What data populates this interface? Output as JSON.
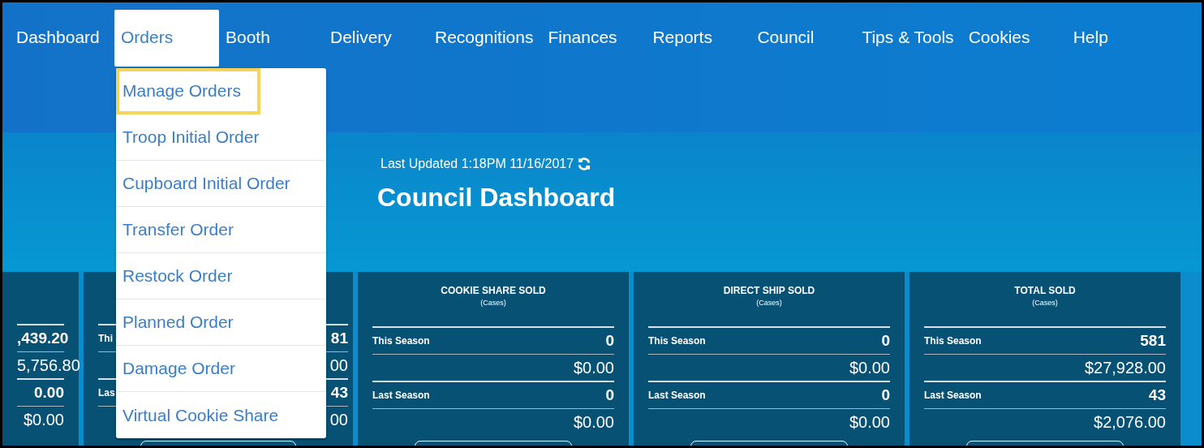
{
  "nav": {
    "items": [
      {
        "label": "Dashboard",
        "selected": false
      },
      {
        "label": "Orders",
        "selected": true
      },
      {
        "label": "Booth",
        "selected": false
      },
      {
        "label": "Delivery",
        "selected": false
      },
      {
        "label": "Recognitions",
        "selected": false
      },
      {
        "label": "Finances",
        "selected": false
      },
      {
        "label": "Reports",
        "selected": false
      },
      {
        "label": "Council",
        "selected": false
      },
      {
        "label": "Tips & Tools",
        "selected": false
      },
      {
        "label": "Cookies",
        "selected": false
      },
      {
        "label": "Help",
        "selected": false
      }
    ]
  },
  "orders_menu": {
    "items": [
      {
        "label": "Manage Orders",
        "highlighted": true
      },
      {
        "label": "Troop Initial Order",
        "highlighted": false
      },
      {
        "label": "Cupboard Initial Order",
        "highlighted": false
      },
      {
        "label": "Transfer Order",
        "highlighted": false
      },
      {
        "label": "Restock Order",
        "highlighted": false
      },
      {
        "label": "Planned Order",
        "highlighted": false
      },
      {
        "label": "Damage Order",
        "highlighted": false
      },
      {
        "label": "Virtual Cookie Share",
        "highlighted": false
      }
    ]
  },
  "header": {
    "last_updated": "Last Updated 1:18PM 11/16/2017",
    "title": "Council Dashboard"
  },
  "cards": [
    {
      "kind": "cut",
      "this_season_count": ",439.20",
      "this_season_amount": "5,756.80",
      "last_season_count": "0.00",
      "last_season_amount": "$0.00"
    },
    {
      "kind": "covered",
      "this_season_label": "Thi",
      "last_season_label": "Las",
      "this_season_count": "81",
      "this_season_amount": "00",
      "last_season_count": "43",
      "last_season_amount": "00"
    },
    {
      "kind": "full",
      "title": "COOKIE SHARE SOLD",
      "unit": "(Cases)",
      "this_season_label": "This Season",
      "this_season_count": "0",
      "this_season_amount": "$0.00",
      "last_season_label": "Last Season",
      "last_season_count": "0",
      "last_season_amount": "$0.00"
    },
    {
      "kind": "full",
      "title": "DIRECT SHIP SOLD",
      "unit": "(Cases)",
      "this_season_label": "This Season",
      "this_season_count": "0",
      "this_season_amount": "$0.00",
      "last_season_label": "Last Season",
      "last_season_count": "0",
      "last_season_amount": "$0.00"
    },
    {
      "kind": "full",
      "title": "TOTAL SOLD",
      "unit": "(Cases)",
      "this_season_label": "This Season",
      "this_season_count": "581",
      "this_season_amount": "$27,928.00",
      "last_season_label": "Last Season",
      "last_season_count": "43",
      "last_season_amount": "$2,076.00"
    }
  ]
}
